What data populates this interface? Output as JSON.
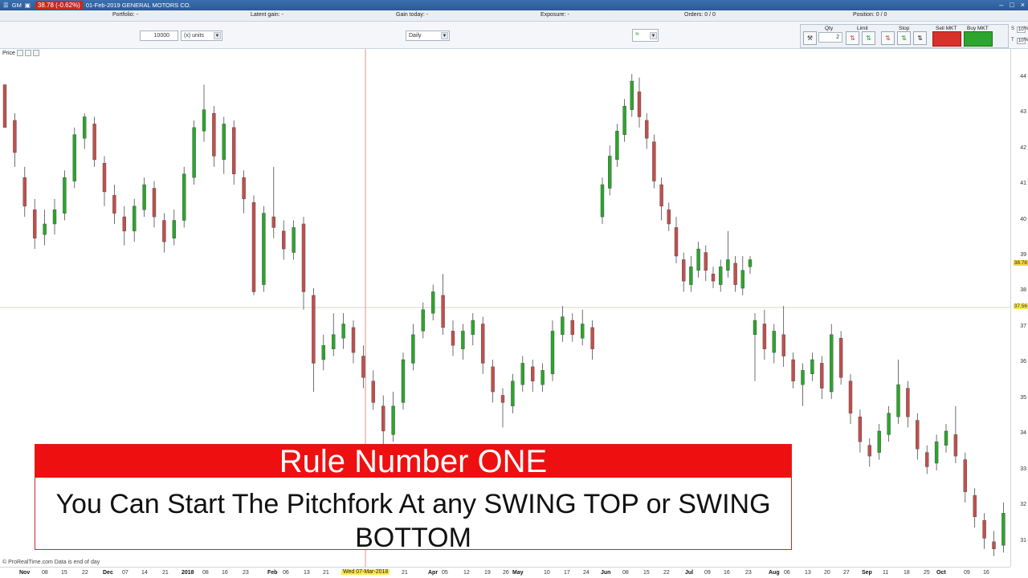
{
  "titlebar": {
    "symbol": "GM",
    "price_change": "38.78 (-0.62%)",
    "date_name": "01-Feb-2019 GENERAL MOTORS CO.",
    "win_min": "–",
    "win_max": "□",
    "win_close": "×"
  },
  "infobar": {
    "portfolio": "Portfolio: -",
    "latent_gain": "Latent gain: -",
    "gain_today": "Gain today: -",
    "exposure": "Exposure: -",
    "orders": "Orders: 0 / 0",
    "position": "Position: 0 / 0"
  },
  "toolbar": {
    "quantity_value": "10000",
    "units_label": "(x) units",
    "period_label": "Daily"
  },
  "order_panel": {
    "qty_label": "Qty",
    "qty_value": "2",
    "limit_label": "Limit",
    "stop_label": "Stop",
    "sell_label": "Sell MKT",
    "buy_label": "Buy MKT",
    "s_label": "S",
    "t_label": "T",
    "pct_1": "%",
    "pct_2": "%",
    "mini_val_1": "10",
    "mini_val_2": "10"
  },
  "chart": {
    "price_label": "Price",
    "copyright": "© ProRealTime.com  Data is end of day",
    "current_price_badge": "38.78",
    "crosshair_price_badge": "37.56",
    "crosshair_date": "Wed 07-Mar-2018",
    "colors": {
      "up": "#2ca52c",
      "down": "#c0504d",
      "crosshair": "#e07a6a"
    }
  },
  "chart_data": {
    "type": "candlestick",
    "ylim": [
      30.3,
      44.8
    ],
    "yticks": [
      "44",
      "43",
      "42",
      "41",
      "40",
      "39",
      "38",
      "37",
      "36",
      "35",
      "34",
      "33",
      "32",
      "31"
    ],
    "xticks": [
      {
        "label": "Nov",
        "bold": true
      },
      {
        "label": "08"
      },
      {
        "label": "15"
      },
      {
        "label": "22"
      },
      {
        "label": "Dec",
        "bold": true
      },
      {
        "label": "07"
      },
      {
        "label": "14"
      },
      {
        "label": "21"
      },
      {
        "label": "2018",
        "bold": true
      },
      {
        "label": "08"
      },
      {
        "label": "16"
      },
      {
        "label": "23"
      },
      {
        "label": "Feb",
        "bold": true
      },
      {
        "label": "06"
      },
      {
        "label": "13"
      },
      {
        "label": "21"
      },
      {
        "label": "21"
      },
      {
        "label": "Apr",
        "bold": true
      },
      {
        "label": "05"
      },
      {
        "label": "12"
      },
      {
        "label": "19"
      },
      {
        "label": "26"
      },
      {
        "label": "May",
        "bold": true
      },
      {
        "label": "10"
      },
      {
        "label": "17"
      },
      {
        "label": "24"
      },
      {
        "label": "Jun",
        "bold": true
      },
      {
        "label": "08"
      },
      {
        "label": "15"
      },
      {
        "label": "22"
      },
      {
        "label": "Jul",
        "bold": true
      },
      {
        "label": "09"
      },
      {
        "label": "16"
      },
      {
        "label": "23"
      },
      {
        "label": "Aug",
        "bold": true
      },
      {
        "label": "06"
      },
      {
        "label": "13"
      },
      {
        "label": "20"
      },
      {
        "label": "27"
      },
      {
        "label": "Sep",
        "bold": true
      },
      {
        "label": "11"
      },
      {
        "label": "18"
      },
      {
        "label": "25"
      },
      {
        "label": "Oct",
        "bold": true
      },
      {
        "label": "09"
      },
      {
        "label": "16"
      }
    ],
    "candles": [
      [
        43.8,
        42.6,
        43.8,
        42.9
      ],
      [
        42.8,
        41.9,
        43.0,
        41.5
      ],
      [
        41.2,
        40.4,
        41.5,
        40.1
      ],
      [
        40.3,
        39.5,
        40.6,
        39.2
      ],
      [
        39.6,
        39.9,
        40.3,
        39.3
      ],
      [
        39.9,
        40.3,
        40.6,
        39.6
      ],
      [
        40.2,
        41.2,
        41.4,
        40.0
      ],
      [
        41.1,
        42.4,
        42.6,
        40.9
      ],
      [
        42.3,
        42.9,
        43.0,
        42.0
      ],
      [
        42.7,
        41.7,
        42.9,
        41.5
      ],
      [
        41.6,
        40.8,
        41.8,
        40.4
      ],
      [
        40.7,
        40.2,
        41.0,
        39.9
      ],
      [
        40.1,
        39.7,
        40.4,
        39.3
      ],
      [
        39.7,
        40.4,
        40.6,
        39.4
      ],
      [
        40.3,
        41.0,
        41.2,
        40.1
      ],
      [
        40.9,
        40.1,
        41.1,
        39.8
      ],
      [
        40.0,
        39.4,
        40.2,
        39.1
      ],
      [
        39.5,
        40.0,
        40.3,
        39.3
      ],
      [
        40.0,
        41.3,
        41.5,
        39.8
      ],
      [
        41.2,
        42.6,
        42.8,
        41.0
      ],
      [
        42.5,
        43.1,
        43.8,
        42.2
      ],
      [
        43.0,
        41.8,
        43.2,
        41.5
      ],
      [
        41.7,
        42.7,
        42.9,
        41.3
      ],
      [
        42.6,
        41.3,
        42.8,
        41.0
      ],
      [
        41.2,
        40.6,
        41.4,
        40.2
      ],
      [
        40.5,
        38.0,
        40.7,
        37.9
      ],
      [
        38.2,
        40.2,
        40.4,
        38.0
      ],
      [
        40.1,
        39.8,
        41.5,
        39.5
      ],
      [
        39.7,
        39.2,
        40.0,
        38.9
      ],
      [
        39.1,
        39.8,
        40.0,
        38.9
      ],
      [
        39.9,
        38.0,
        40.1,
        37.5
      ],
      [
        37.9,
        36.0,
        38.1,
        35.2
      ],
      [
        36.1,
        36.5,
        36.8,
        35.8
      ],
      [
        36.4,
        36.8,
        37.4,
        36.2
      ],
      [
        36.7,
        37.1,
        37.4,
        36.4
      ],
      [
        37.0,
        36.3,
        37.2,
        36.0
      ],
      [
        36.2,
        35.6,
        36.5,
        35.3
      ],
      [
        35.5,
        34.9,
        35.8,
        34.7
      ],
      [
        34.8,
        34.1,
        35.1,
        33.5
      ],
      [
        34.0,
        34.8,
        35.2,
        33.8
      ],
      [
        34.9,
        36.1,
        36.3,
        34.7
      ],
      [
        36.0,
        36.8,
        37.1,
        35.8
      ],
      [
        36.9,
        37.5,
        37.7,
        36.7
      ],
      [
        37.4,
        38.0,
        38.2,
        37.2
      ],
      [
        37.9,
        37.0,
        38.5,
        36.8
      ],
      [
        36.9,
        36.5,
        37.2,
        36.2
      ],
      [
        36.4,
        36.9,
        37.1,
        36.1
      ],
      [
        36.8,
        37.2,
        37.4,
        36.5
      ],
      [
        37.1,
        36.0,
        37.3,
        35.7
      ],
      [
        35.9,
        35.2,
        36.1,
        34.9
      ],
      [
        35.1,
        34.9,
        35.3,
        34.2
      ],
      [
        34.8,
        35.5,
        35.7,
        34.6
      ],
      [
        35.4,
        36.0,
        36.2,
        35.2
      ],
      [
        35.9,
        35.5,
        36.1,
        35.2
      ],
      [
        35.4,
        35.8,
        36.0,
        35.2
      ],
      [
        35.7,
        36.9,
        37.2,
        35.5
      ],
      [
        36.8,
        37.3,
        37.6,
        36.6
      ],
      [
        37.2,
        36.8,
        37.4,
        36.6
      ],
      [
        36.7,
        37.1,
        37.5,
        36.5
      ],
      [
        37.0,
        36.4,
        37.2,
        36.1
      ],
      [
        40.1,
        41.0,
        41.2,
        39.9
      ],
      [
        40.9,
        41.8,
        42.1,
        40.7
      ],
      [
        41.7,
        42.5,
        42.7,
        41.5
      ],
      [
        42.4,
        43.2,
        43.4,
        42.2
      ],
      [
        43.1,
        43.9,
        44.1,
        42.9
      ],
      [
        43.6,
        42.9,
        44.0,
        42.6
      ],
      [
        42.8,
        42.3,
        43.0,
        42.0
      ],
      [
        42.2,
        41.1,
        42.4,
        40.9
      ],
      [
        41.0,
        40.4,
        41.2,
        40.0
      ],
      [
        40.3,
        39.9,
        40.5,
        39.7
      ],
      [
        39.8,
        39.0,
        40.1,
        38.8
      ],
      [
        38.9,
        38.3,
        39.1,
        38.0
      ],
      [
        38.2,
        38.7,
        39.0,
        38.0
      ],
      [
        38.6,
        39.2,
        39.4,
        38.4
      ],
      [
        39.1,
        38.6,
        39.3,
        38.3
      ],
      [
        38.5,
        38.3,
        38.7,
        38.1
      ],
      [
        38.2,
        38.7,
        38.9,
        38.0
      ],
      [
        38.6,
        38.9,
        39.7,
        38.4
      ],
      [
        38.8,
        38.2,
        39.0,
        38.0
      ],
      [
        38.1,
        38.6,
        39.0,
        37.9
      ],
      [
        38.7,
        38.9,
        39.0,
        38.5
      ],
      [
        36.8,
        37.2,
        37.4,
        35.5
      ],
      [
        37.1,
        36.4,
        37.5,
        36.1
      ],
      [
        36.3,
        36.9,
        37.1,
        36.0
      ],
      [
        36.8,
        36.2,
        37.6,
        35.9
      ],
      [
        36.1,
        35.5,
        36.3,
        35.3
      ],
      [
        35.4,
        35.8,
        36.0,
        34.8
      ],
      [
        35.7,
        36.1,
        36.3,
        35.5
      ],
      [
        36.0,
        35.3,
        36.2,
        35.0
      ],
      [
        35.2,
        36.8,
        37.1,
        35.0
      ],
      [
        36.7,
        35.6,
        36.9,
        35.4
      ],
      [
        35.5,
        34.6,
        35.7,
        34.3
      ],
      [
        34.5,
        33.8,
        34.7,
        33.5
      ],
      [
        33.7,
        33.4,
        33.9,
        33.1
      ],
      [
        33.5,
        34.1,
        34.3,
        33.3
      ],
      [
        34.0,
        34.6,
        34.8,
        33.8
      ],
      [
        34.5,
        35.4,
        36.1,
        34.3
      ],
      [
        35.3,
        34.5,
        35.5,
        34.2
      ],
      [
        34.4,
        33.6,
        34.6,
        33.3
      ],
      [
        33.5,
        33.1,
        33.7,
        32.9
      ],
      [
        33.2,
        33.8,
        34.0,
        33.0
      ],
      [
        33.7,
        34.1,
        34.3,
        33.5
      ],
      [
        34.0,
        33.4,
        34.8,
        33.2
      ],
      [
        33.3,
        32.4,
        33.5,
        32.1
      ],
      [
        32.3,
        31.7,
        32.5,
        31.4
      ],
      [
        31.6,
        31.1,
        31.8,
        30.8
      ],
      [
        31.0,
        30.8,
        31.3,
        30.6
      ],
      [
        30.9,
        31.8,
        32.1,
        30.7
      ]
    ]
  },
  "overlay": {
    "heading": "Rule Number ONE",
    "body": "You Can Start The Pitchfork At any SWING TOP or SWING BOTTOM"
  }
}
